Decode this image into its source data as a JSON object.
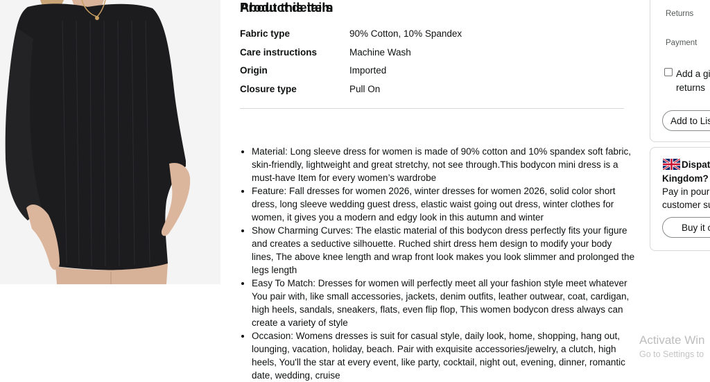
{
  "product_details": {
    "title": "Product details",
    "rows": [
      {
        "key": "Fabric type",
        "value": "90% Cotton, 10% Spandex"
      },
      {
        "key": "Care instructions",
        "value": "Machine Wash"
      },
      {
        "key": "Origin",
        "value": "Imported"
      },
      {
        "key": "Closure type",
        "value": "Pull On"
      }
    ]
  },
  "about": {
    "title": "About this item",
    "bullets": [
      "Material: Long sleeve dress for women is made of 90% cotton and 10% spandex soft fabric, skin-friendly, lightweight and great stretchy, not see through.This bodycon mini dress is a must-have Item for every women’s wardrobe",
      "Feature: Fall dresses for women 2026, winter dresses for women 2026, solid color short dress, long sleeve wedding guest dress, elastic waist going out dress, winter clothes for women, it gives you a modern and edgy look in this autumn and winter",
      "Show Charming Curves: The elastic material of this bodycon dress perfectly fits your figure and creates a seductive silhouette. Ruched shirt dress hem design to modify your body lines, The above knee length and wrap front look makes you look slimmer and prolonged the legs length",
      "Easy To Match: Dresses for women will perfectly meet all your fashion style meet whatever You pair with, like small accessories, jackets, denim outfits, leather outwear, coat, cardigan, high heels, sandals, sneakers, flats, even flip flop, This women bodycon dress always can create a variety of style",
      "Occasion: Womens dresses is suit for casual style, daily look, home, shopping, hang out, lounging, vacation, holiday, beach. Pair with exquisite accessories/jewelry, a clutch, high heels, You'll the star at every event, like party, cocktail, night out, evening, dinner, romantic date, wedding, cruise"
    ]
  },
  "buybox": {
    "returns_label": "Returns",
    "payment_label": "Payment",
    "gift_line1": "Add a gi",
    "gift_line2": "returns",
    "add_to_list": "Add to Lis"
  },
  "dispatch": {
    "title_line1": "Dispat",
    "title_line2": "Kingdom?",
    "body_line1": "Pay in pour",
    "body_line2": "customer su",
    "buy_button": "Buy it o"
  },
  "watermark": {
    "line1": "Activate Win",
    "line2": "Go to Settings to"
  },
  "colors": {
    "text": "#0f1111",
    "border": "#d5d9d9",
    "dress": "#1c1c1e"
  }
}
